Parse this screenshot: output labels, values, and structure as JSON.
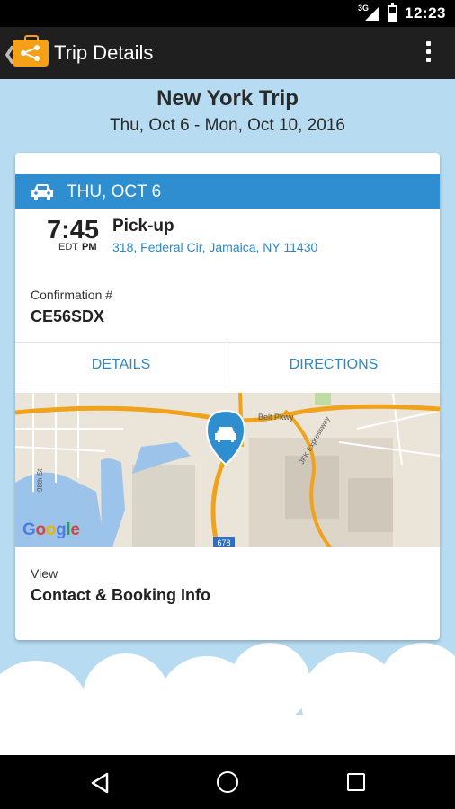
{
  "status_bar": {
    "network": "3G",
    "time": "12:23"
  },
  "app_bar": {
    "title": "Trip Details",
    "back_icon": "chevron-left-icon",
    "logo_icon": "suitcase-share-icon",
    "menu_icon": "overflow-menu-icon"
  },
  "trip": {
    "name": "New York Trip",
    "dates": "Thu, Oct 6 - Mon, Oct 10, 2016"
  },
  "segment": {
    "day": "THU, OCT 6",
    "header_color": "#2e8ed0",
    "time": "7:45",
    "timezone": "EDT",
    "ampm": "PM",
    "title": "Pick-up",
    "address": "318, Federal Cir, Jamaica, NY 11430",
    "confirmation_label": "Confirmation #",
    "confirmation_value": "CE56SDX",
    "details_label": "DETAILS",
    "directions_label": "DIRECTIONS"
  },
  "map": {
    "road_labels": [
      "Belt Pkwy",
      "JFK Expressway",
      "98th St",
      "678"
    ],
    "attribution": [
      "G",
      "o",
      "o",
      "g",
      "l",
      "e"
    ]
  },
  "contact": {
    "label": "View",
    "title": "Contact & Booking Info"
  },
  "colors": {
    "accent": "#2a87c8",
    "logo": "#f6a01a",
    "sky": "#b7dcf2"
  }
}
